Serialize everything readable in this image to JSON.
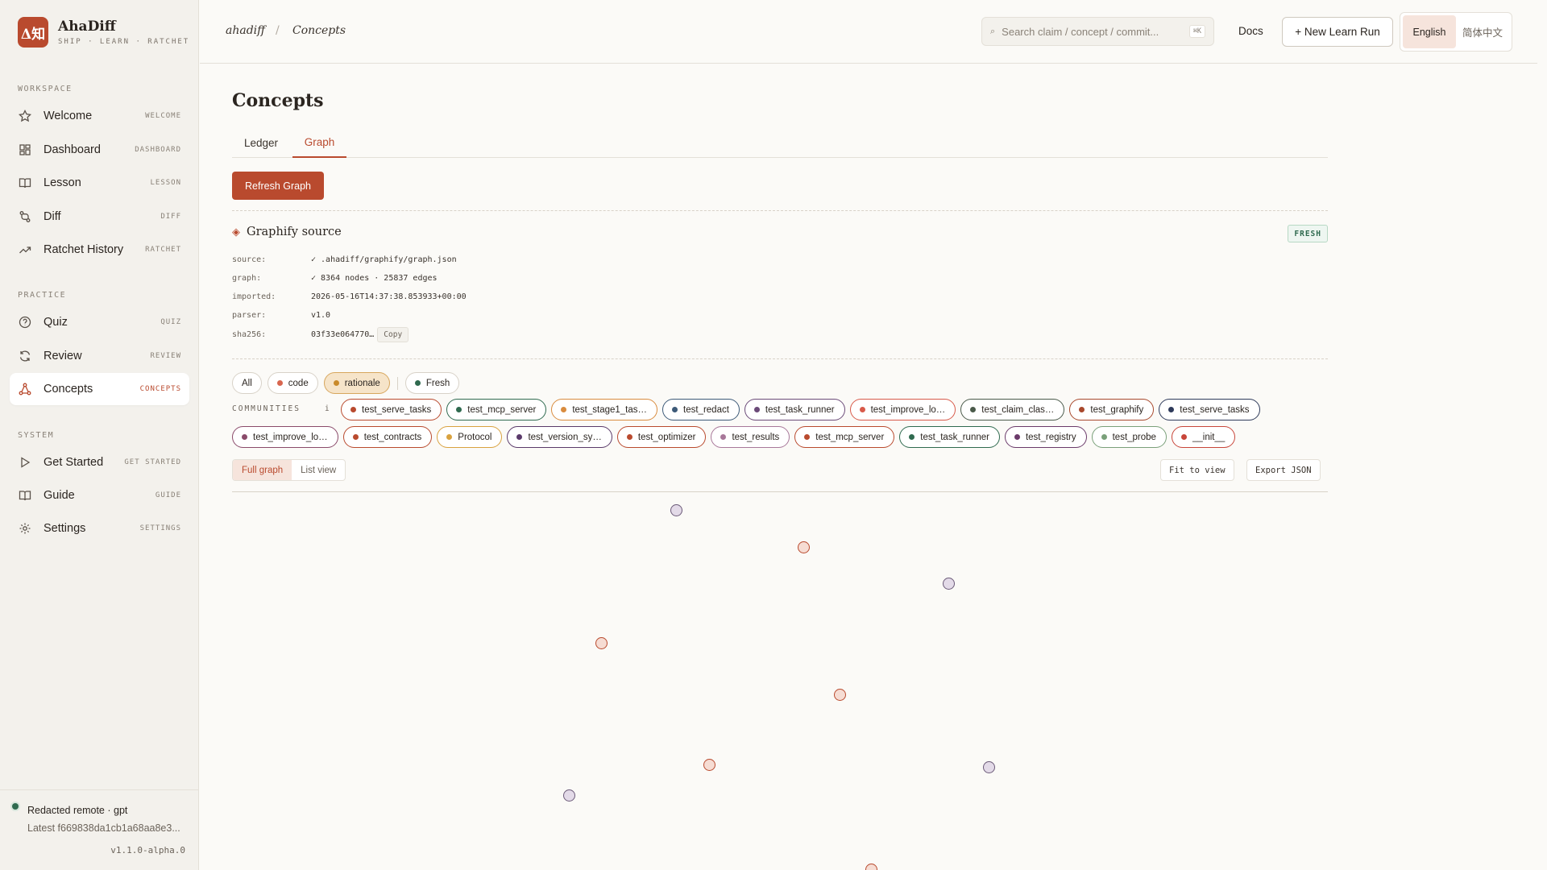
{
  "brand": {
    "logo_text": "Δ知",
    "name": "AhaDiff",
    "tagline": "SHIP · LEARN · RATCHET"
  },
  "sidebar": {
    "sections": {
      "workspace": "WORKSPACE",
      "practice": "PRACTICE",
      "system": "SYSTEM"
    },
    "items": [
      {
        "label": "Welcome",
        "key": "WELCOME",
        "icon": "star-icon"
      },
      {
        "label": "Dashboard",
        "key": "DASHBOARD",
        "icon": "dashboard-icon"
      },
      {
        "label": "Lesson",
        "key": "LESSON",
        "icon": "book-icon"
      },
      {
        "label": "Diff",
        "key": "DIFF",
        "icon": "diff-icon"
      },
      {
        "label": "Ratchet History",
        "key": "RATCHET",
        "icon": "trend-icon"
      },
      {
        "label": "Quiz",
        "key": "QUIZ",
        "icon": "question-icon"
      },
      {
        "label": "Review",
        "key": "REVIEW",
        "icon": "refresh-icon"
      },
      {
        "label": "Concepts",
        "key": "CONCEPTS",
        "icon": "graph-icon",
        "active": true
      },
      {
        "label": "Get Started",
        "key": "GET STARTED",
        "icon": "play-icon"
      },
      {
        "label": "Guide",
        "key": "GUIDE",
        "icon": "book-open-icon"
      },
      {
        "label": "Settings",
        "key": "SETTINGS",
        "icon": "gear-icon"
      }
    ],
    "footer": {
      "remote": "Redacted remote · gpt",
      "latest": "Latest f669838da1cb1a68aa8e3...",
      "version": "v1.1.0-alpha.0"
    }
  },
  "topbar": {
    "breadcrumb": {
      "root": "ahadiff",
      "sep": "/",
      "current": "Concepts"
    },
    "search": {
      "placeholder": "Search claim / concept / commit...",
      "shortcut": "⌘K"
    },
    "docs": "Docs",
    "new_run": "+ New Learn Run",
    "lang": {
      "english": "English",
      "chinese": "简体中文",
      "active": "english"
    }
  },
  "main": {
    "title": "Concepts",
    "tabs": [
      {
        "label": "Ledger"
      },
      {
        "label": "Graph",
        "active": true
      }
    ],
    "refresh_button": "Refresh Graph",
    "source": {
      "title": "Graphify source",
      "badge": "FRESH",
      "rows": [
        {
          "key": "source:",
          "value": "✓ .ahadiff/graphify/graph.json"
        },
        {
          "key": "graph:",
          "value": "✓ 8364 nodes · 25837 edges"
        },
        {
          "key": "imported:",
          "value": "2026-05-16T14:37:38.853933+00:00"
        },
        {
          "key": "parser:",
          "value": "v1.0"
        },
        {
          "key": "sha256:",
          "value": "03f33e064770…",
          "action": "Copy"
        }
      ]
    },
    "filters": {
      "all": "All",
      "code": "code",
      "rationale": "rationale",
      "fresh": "Fresh",
      "selected": "rationale"
    },
    "communities": {
      "label": "COMMUNITIES",
      "info": "i",
      "row1": [
        {
          "label": "test_serve_tasks",
          "color": "#b94a2e"
        },
        {
          "label": "test_mcp_server",
          "color": "#2f6a4f"
        },
        {
          "label": "test_stage1_tas…",
          "color": "#d98c3f"
        },
        {
          "label": "test_redact",
          "color": "#3d5a78"
        },
        {
          "label": "test_task_runner",
          "color": "#6b4a78"
        },
        {
          "label": "test_improve_lo…",
          "color": "#d85a4a"
        },
        {
          "label": "test_claim_clas…",
          "color": "#4a5a4a"
        },
        {
          "label": "test_graphify",
          "color": "#a8482c"
        },
        {
          "label": "test_serve_tasks",
          "color": "#2e3a5a"
        }
      ],
      "row2": [
        {
          "label": "test_improve_lo…",
          "color": "#8a4a6a"
        },
        {
          "label": "test_contracts",
          "color": "#b94a2e"
        },
        {
          "label": "Protocol",
          "color": "#d9a23f"
        },
        {
          "label": "test_version_sy…",
          "color": "#5a3a6a"
        },
        {
          "label": "test_optimizer",
          "color": "#b94a2e"
        },
        {
          "label": "test_results",
          "color": "#a8789a"
        },
        {
          "label": "test_mcp_server",
          "color": "#b94a2e"
        },
        {
          "label": "test_task_runner",
          "color": "#2f6a4f"
        },
        {
          "label": "test_registry",
          "color": "#6b3a6a"
        },
        {
          "label": "test_probe",
          "color": "#7aa07a"
        },
        {
          "label": "__init__",
          "color": "#c8463a"
        }
      ]
    },
    "view": {
      "full": "Full graph",
      "list": "List view",
      "active": "full"
    },
    "tools": {
      "fit": "Fit to view",
      "export": "Export JSON"
    }
  }
}
